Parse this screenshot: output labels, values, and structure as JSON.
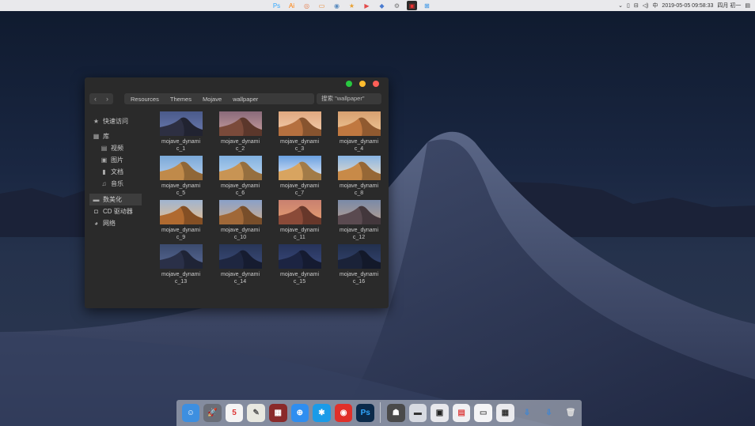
{
  "menubar": {
    "apple": "",
    "tray_icons": [
      {
        "name": "ps-tray-icon",
        "glyph": "Ps",
        "color": "#31a8ff"
      },
      {
        "name": "ai-tray-icon",
        "glyph": "Ai",
        "color": "#ff7c00"
      },
      {
        "name": "circle-tray-icon",
        "glyph": "◎",
        "color": "#e57c4a"
      },
      {
        "name": "frame-tray-icon",
        "glyph": "▭",
        "color": "#e67e22"
      },
      {
        "name": "camera-tray-icon",
        "glyph": "◉",
        "color": "#5a8bbf"
      },
      {
        "name": "star-tray-icon",
        "glyph": "★",
        "color": "#e8a031"
      },
      {
        "name": "video-tray-icon",
        "glyph": "▶",
        "color": "#e34b4b"
      },
      {
        "name": "blue-tray-icon",
        "glyph": "◆",
        "color": "#4a7bd0"
      },
      {
        "name": "gear-tray-icon",
        "glyph": "⚙",
        "color": "#777"
      },
      {
        "name": "monitor-tray-icon",
        "glyph": "▣",
        "color": "#e33"
      },
      {
        "name": "windows-tray-icon",
        "glyph": "⊞",
        "color": "#1e88e5"
      }
    ],
    "status": {
      "chevron": "⌄",
      "battery": "▯",
      "network": "⊟",
      "volume": "◁)",
      "ime": "中",
      "datetime": "2019-05-05  09:58:33",
      "lunar": "四月 初一",
      "notification": "▤"
    }
  },
  "finder": {
    "breadcrumbs": [
      "Resources",
      "Themes",
      "Mojave",
      "wallpaper"
    ],
    "search_placeholder": "搜索 \"wallpaper\"",
    "nav_back": "‹",
    "nav_forward": "›",
    "sidebar": [
      {
        "id": "quick",
        "label": "快速访问",
        "icon": "★",
        "sub": false
      },
      {
        "id": "library",
        "label": "库",
        "icon": "▦",
        "sub": false
      },
      {
        "id": "video",
        "label": "视频",
        "icon": "▤",
        "sub": true
      },
      {
        "id": "pictures",
        "label": "图片",
        "icon": "▣",
        "sub": true
      },
      {
        "id": "documents",
        "label": "文档",
        "icon": "▮",
        "sub": true
      },
      {
        "id": "music",
        "label": "音乐",
        "icon": "♫",
        "sub": true
      },
      {
        "id": "computer",
        "label": "数美化",
        "icon": "▬",
        "sub": false,
        "active": true
      },
      {
        "id": "cd",
        "label": "CD 驱动器",
        "icon": "◘",
        "sub": false
      },
      {
        "id": "network",
        "label": "网络",
        "icon": "◕",
        "sub": false
      }
    ],
    "files": [
      {
        "l1": "mojave_dynami",
        "l2": "c_1",
        "sky": "#4a5a8a",
        "sand": "#2d2f42",
        "sun": "#6c7bb0"
      },
      {
        "l1": "mojave_dynami",
        "l2": "c_2",
        "sky": "#8a6a7a",
        "sand": "#7a4a3a",
        "sun": "#c9a0a0"
      },
      {
        "l1": "mojave_dynami",
        "l2": "c_3",
        "sky": "#e0a880",
        "sand": "#b5703f",
        "sun": "#f5d0b0"
      },
      {
        "l1": "mojave_dynami",
        "l2": "c_4",
        "sky": "#d8a070",
        "sand": "#c07840",
        "sun": "#f0c898"
      },
      {
        "l1": "mojave_dynami",
        "l2": "c_5",
        "sky": "#7aa8d8",
        "sand": "#c08a4a",
        "sun": "#b8d0ec"
      },
      {
        "l1": "mojave_dynami",
        "l2": "c_6",
        "sky": "#80b0e0",
        "sand": "#c89454",
        "sun": "#c0d8f0"
      },
      {
        "l1": "mojave_dynami",
        "l2": "c_7",
        "sky": "#6aa0e0",
        "sand": "#d8a460",
        "sun": "#e8eef8"
      },
      {
        "l1": "mojave_dynami",
        "l2": "c_8",
        "sky": "#88b4e4",
        "sand": "#c88a48",
        "sun": "#f0e0c8"
      },
      {
        "l1": "mojave_dynami",
        "l2": "c_9",
        "sky": "#a0b4d0",
        "sand": "#b06a30",
        "sun": "#e8c090"
      },
      {
        "l1": "mojave_dynami",
        "l2": "c_10",
        "sky": "#8aa0c8",
        "sand": "#a06838",
        "sun": "#d0b090"
      },
      {
        "l1": "mojave_dynami",
        "l2": "c_11",
        "sky": "#c88070",
        "sand": "#8a4a38",
        "sun": "#e8a070"
      },
      {
        "l1": "mojave_dynami",
        "l2": "c_12",
        "sky": "#7a8aa8",
        "sand": "#5a4a50",
        "sun": "#b8a090"
      },
      {
        "l1": "mojave_dynami",
        "l2": "c_13",
        "sky": "#3a4a6e",
        "sand": "#2a3048",
        "sun": "#5a6a94"
      },
      {
        "l1": "mojave_dynami",
        "l2": "c_14",
        "sky": "#283658",
        "sand": "#1e2640",
        "sun": "#3c4c7a"
      },
      {
        "l1": "mojave_dynami",
        "l2": "c_15",
        "sky": "#26335a",
        "sand": "#1c2442",
        "sun": "#3a4a7c"
      },
      {
        "l1": "mojave_dynami",
        "l2": "c_16",
        "sky": "#22304e",
        "sand": "#1a2238",
        "sun": "#344470"
      }
    ]
  },
  "dock": [
    {
      "name": "finder-dock-icon",
      "glyph": "☺",
      "bg": "#3d8fe0"
    },
    {
      "name": "launchpad-dock-icon",
      "glyph": "🚀",
      "bg": "#6a6e78"
    },
    {
      "name": "calendar-dock-icon",
      "glyph": "5",
      "bg": "#f4f4f4",
      "fg": "#d33"
    },
    {
      "name": "notes-dock-icon",
      "glyph": "✎",
      "bg": "#e8e8e0",
      "fg": "#555"
    },
    {
      "name": "photo-booth-dock-icon",
      "glyph": "▦",
      "bg": "#8a2a2a"
    },
    {
      "name": "safari-dock-icon",
      "glyph": "⊕",
      "bg": "#2f8ef0"
    },
    {
      "name": "app-store-dock-icon",
      "glyph": "✱",
      "bg": "#1a9be8"
    },
    {
      "name": "netease-music-dock-icon",
      "glyph": "◉",
      "bg": "#e0302a"
    },
    {
      "name": "photoshop-dock-icon",
      "glyph": "Ps",
      "bg": "#0b2a4a",
      "fg": "#31a8ff"
    },
    {
      "sep": true
    },
    {
      "name": "preview-dock-icon",
      "glyph": "☗",
      "bg": "#4a4a4a"
    },
    {
      "name": "window-thumb-1-dock-icon",
      "glyph": "▬",
      "bg": "#d8dbe2",
      "fg": "#333"
    },
    {
      "name": "window-thumb-2-dock-icon",
      "glyph": "▣",
      "bg": "#e8e8ec",
      "fg": "#222"
    },
    {
      "name": "window-thumb-3-dock-icon",
      "glyph": "▤",
      "bg": "#f0f0f2",
      "fg": "#d44"
    },
    {
      "name": "window-thumb-4-dock-icon",
      "glyph": "▭",
      "bg": "#f4f4f6",
      "fg": "#555"
    },
    {
      "name": "window-thumb-5-dock-icon",
      "glyph": "▦",
      "bg": "#eaeaee",
      "fg": "#333"
    },
    {
      "name": "downloads-dock-icon",
      "glyph": "⇩",
      "bg": "transparent",
      "fg": "#3a86d8"
    },
    {
      "name": "folder-dock-icon",
      "glyph": "⇩",
      "bg": "transparent",
      "fg": "#3a86d8"
    },
    {
      "name": "trash-dock-icon",
      "glyph": "🗑",
      "bg": "transparent",
      "fg": "#ddd"
    }
  ]
}
